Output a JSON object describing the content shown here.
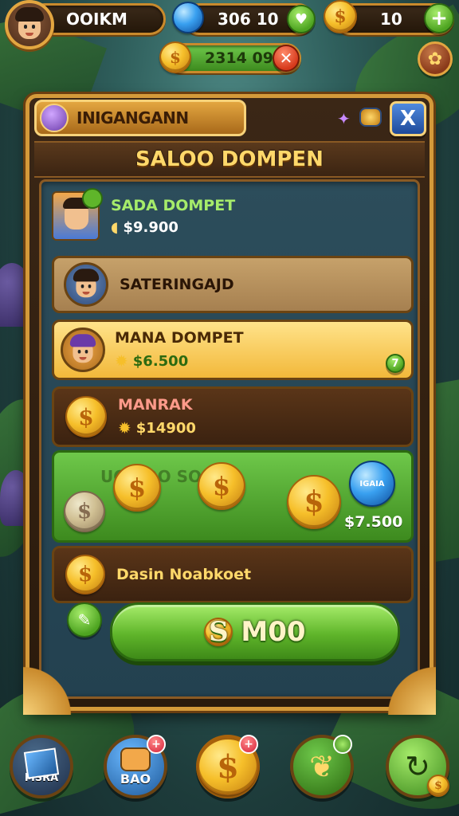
{
  "hud": {
    "player_name": "OOIKM",
    "gems": "306 10",
    "coins": "10",
    "wallet_total": "2314 090"
  },
  "panel": {
    "tab_title": "INIGANGANN",
    "title": "SALOO DOMPEN",
    "close_label": "X"
  },
  "rows": [
    {
      "name": "SADA DOMPET",
      "amount": "$9.900"
    },
    {
      "name": "SATERINGAJD",
      "amount": ""
    },
    {
      "name": "MANA DOMPET",
      "amount": "$6.500",
      "badge": "7"
    },
    {
      "name": "MANRAK",
      "amount": "$14900"
    },
    {
      "name": "Dasin Noabkoet",
      "amount": ""
    }
  ],
  "coin_row": {
    "caption": "UO SOO SO 00",
    "gem_label": "IGAIA",
    "amount": "$7.500"
  },
  "big_button": {
    "label": "M00",
    "icon_text": "S"
  },
  "nav": {
    "item1": "MSRA",
    "item2": "BAO",
    "badge1": "+",
    "badge2": "+"
  },
  "colors": {
    "gold": "#f6bf2a",
    "green": "#5fb52a",
    "wood": "#3b2716",
    "panel_blue": "#2c4d5b"
  }
}
